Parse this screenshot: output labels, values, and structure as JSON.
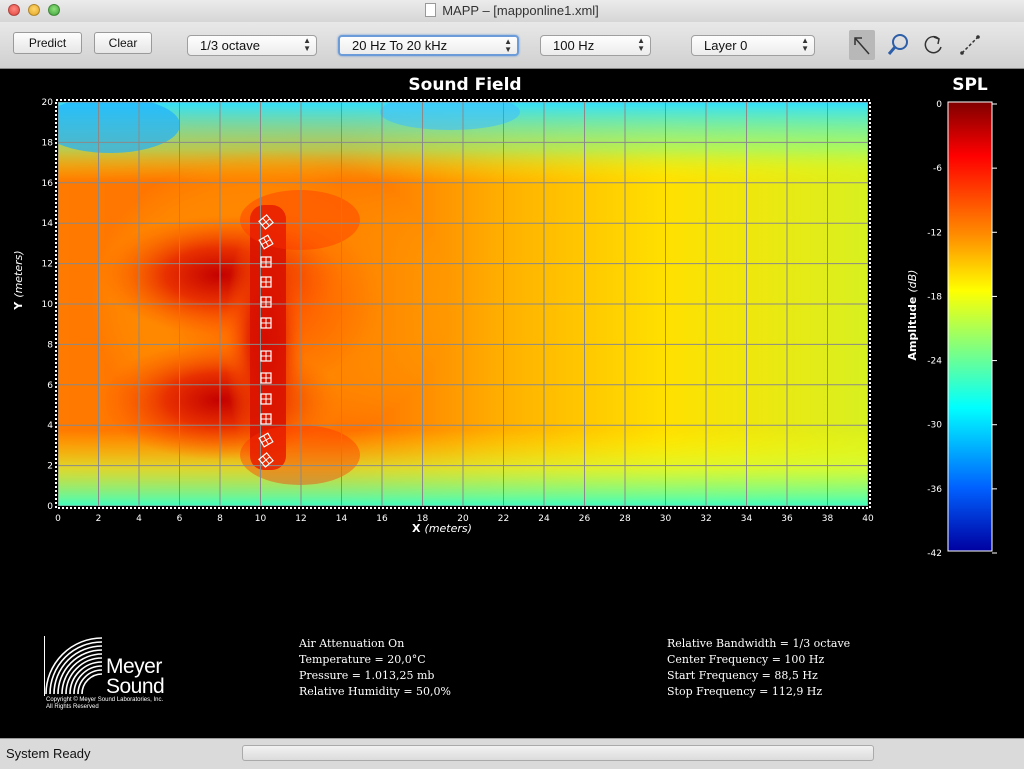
{
  "window": {
    "title": "MAPP – [mapponline1.xml]"
  },
  "toolbar": {
    "predict_label": "Predict",
    "clear_label": "Clear",
    "bandwidth_select": "1/3 octave",
    "range_select": "20 Hz To 20 kHz",
    "frequency_select": "100 Hz",
    "layer_select": "Layer 0",
    "tools": [
      "arrow-select-icon",
      "zoom-magnifier-icon",
      "rotate-icon",
      "measure-line-icon"
    ]
  },
  "plot": {
    "title": "Sound Field",
    "x_axis_letter": "X",
    "x_axis_unit": "(meters)",
    "y_axis_letter": "Y",
    "y_axis_unit": "(meters)",
    "x_ticks": [
      "0",
      "2",
      "4",
      "6",
      "8",
      "10",
      "12",
      "14",
      "16",
      "18",
      "20",
      "22",
      "24",
      "26",
      "28",
      "30",
      "32",
      "34",
      "36",
      "38",
      "40"
    ],
    "y_ticks": [
      "0",
      "2",
      "4",
      "6",
      "8",
      "10",
      "12",
      "14",
      "16",
      "18",
      "20"
    ]
  },
  "scale": {
    "title": "SPL",
    "label": "Amplitude",
    "unit": "(dB)",
    "ticks": [
      "0",
      "-6",
      "-12",
      "-18",
      "-24",
      "-30",
      "-36",
      "-42"
    ]
  },
  "environment": {
    "lines": [
      "Air Attenuation On",
      "Temperature = 20,0°C",
      "Pressure = 1.013,25  mb",
      "Relative Humidity = 50,0%"
    ]
  },
  "frequency_info": {
    "lines": [
      "Relative Bandwidth = 1/3 octave",
      "Center Frequency = 100 Hz",
      "Start Frequency = 88,5 Hz",
      "Stop Frequency = 112,9 Hz"
    ]
  },
  "logo": {
    "line1": "Meyer",
    "line2": "Sound",
    "copyright1": "Copyright © Meyer Sound Laboratories, Inc.",
    "copyright2": "All Rights Reserved"
  },
  "status": {
    "text": "System Ready"
  },
  "colors": {
    "accent_focus": "#6b9bd8",
    "plot_background": "#000000"
  }
}
